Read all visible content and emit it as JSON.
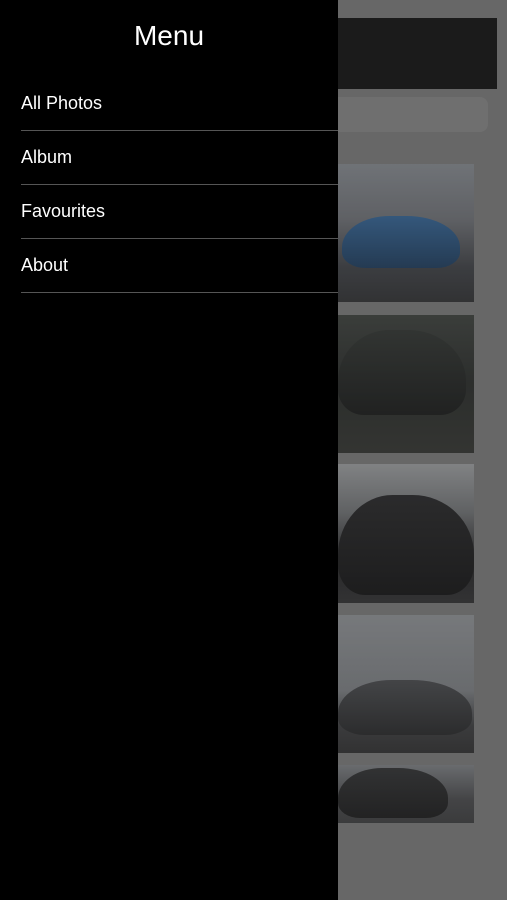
{
  "drawer": {
    "title": "Menu",
    "items": [
      {
        "label": "All Photos"
      },
      {
        "label": "Album"
      },
      {
        "label": "Favourites"
      },
      {
        "label": "About"
      }
    ]
  },
  "colors": {
    "drawer_bg": "#000000",
    "text": "#ffffff",
    "divider": "#555555"
  }
}
